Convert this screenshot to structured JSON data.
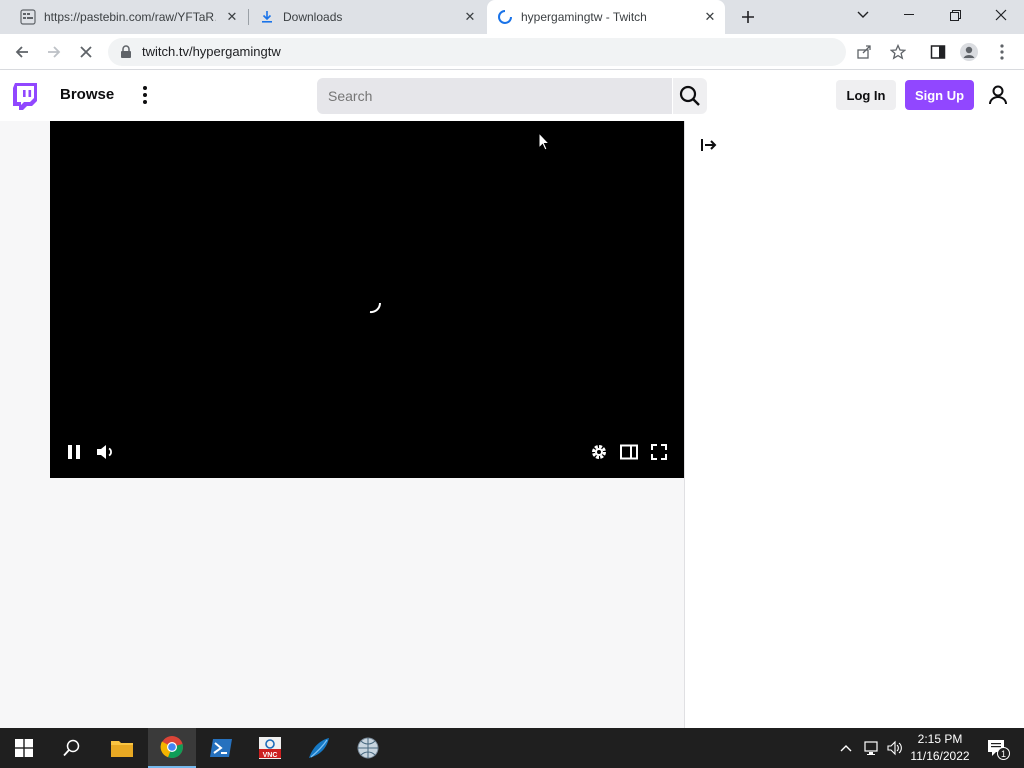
{
  "browser": {
    "tabs": [
      {
        "title": "https://pastebin.com/raw/YFTaR…",
        "icon": "pastebin-icon",
        "active": false
      },
      {
        "title": "Downloads",
        "icon": "download-icon",
        "active": false
      },
      {
        "title": "hypergamingtw - Twitch",
        "icon": "loading-spinner-icon",
        "active": true
      }
    ],
    "url": "twitch.tv/hypergamingtw"
  },
  "twitch": {
    "browse_label": "Browse",
    "search_placeholder": "Search",
    "login_label": "Log In",
    "signup_label": "Sign Up",
    "brand_color": "#9147ff"
  },
  "taskbar": {
    "apps": [
      "start",
      "search",
      "file-explorer",
      "chrome",
      "powershell",
      "vnc-viewer",
      "wireshark",
      "network-tool"
    ],
    "time": "2:15 PM",
    "date": "11/16/2022",
    "notification_count": "1"
  }
}
